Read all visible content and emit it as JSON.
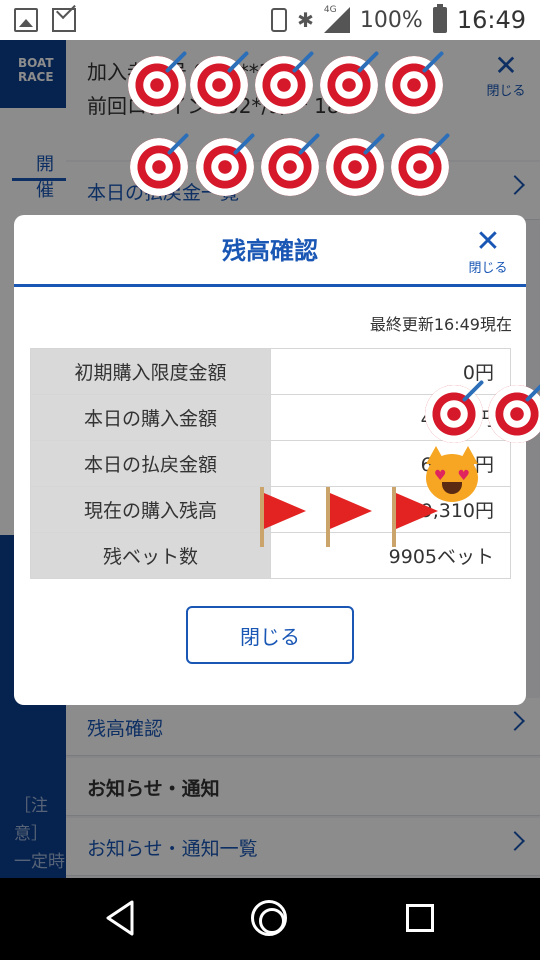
{
  "status_bar": {
    "battery": "100%",
    "time": "16:49",
    "network": "4G"
  },
  "background": {
    "logo": "BOAT RACE",
    "tab_label": "開催",
    "info_line1": "加入者番号 07****38",
    "info_line2": "前回ログイン 202*/9/** 18",
    "close_label": "閉じる",
    "menu": [
      {
        "label": "本日の払戻金一覧"
      },
      {
        "label": "残高確認"
      },
      {
        "label": "お知らせ・通知"
      },
      {
        "label": "お知らせ・通知一覧"
      }
    ],
    "note_line1": "［注意］",
    "note_line2": "一定時"
  },
  "modal": {
    "title": "残高確認",
    "close_label": "閉じる",
    "updated": "最終更新16:49現在",
    "rows": [
      {
        "label": "初期購入限度金額",
        "value": "0円"
      },
      {
        "label": "本日の購入金額",
        "value": "4,000円"
      },
      {
        "label": "本日の払戻金額",
        "value": "6,000円"
      },
      {
        "label": "現在の購入残高",
        "value": "99,310円"
      },
      {
        "label": "残ベット数",
        "value": "9905ベット"
      }
    ],
    "close_button": "閉じる"
  },
  "stickers": {
    "target_icon": "direct-hit",
    "flag_icon": "triangular-flag",
    "cat_icon": "heart-eyes-cat"
  }
}
